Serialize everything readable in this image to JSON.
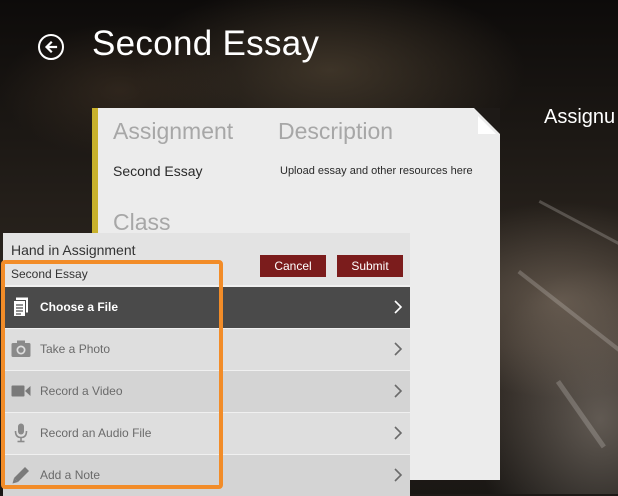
{
  "header": {
    "title": "Second Essay",
    "back_icon": "back-arrow-icon",
    "side_label": "Assignu"
  },
  "card": {
    "assignment_header": "Assignment",
    "description_header": "Description",
    "assignment_value": "Second Essay",
    "description_value": "Upload essay and other resources here",
    "class_header": "Class",
    "accent_color": "#c8b12c"
  },
  "dialog": {
    "title": "Hand in Assignment",
    "subtitle": "Second Essay",
    "cancel_label": "Cancel",
    "submit_label": "Submit",
    "button_color": "#7b1c1c",
    "options": [
      {
        "label": "Choose a File",
        "icon": "document-icon",
        "active": true
      },
      {
        "label": "Take a Photo",
        "icon": "camera-icon",
        "active": false
      },
      {
        "label": "Record a Video",
        "icon": "video-camera-icon",
        "active": false
      },
      {
        "label": "Record an Audio File",
        "icon": "microphone-icon",
        "active": false
      },
      {
        "label": "Add a Note",
        "icon": "pencil-icon",
        "active": false
      }
    ]
  },
  "highlight_color": "#f28c28"
}
